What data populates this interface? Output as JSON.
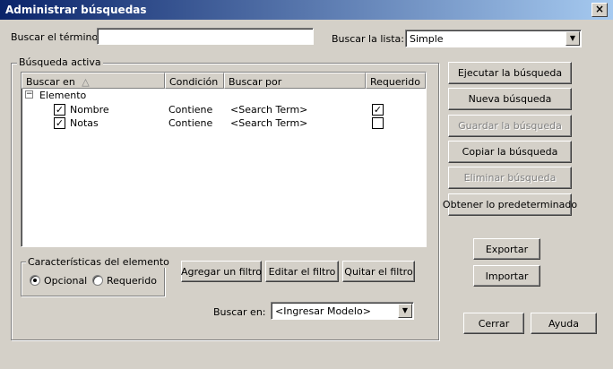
{
  "window": {
    "title": "Administrar búsquedas",
    "close_glyph": "×"
  },
  "top": {
    "term_label": "Buscar el término:",
    "term_value": "",
    "list_label": "Buscar la lista:",
    "list_value": "Simple"
  },
  "active_search": {
    "legend": "Búsqueda activa",
    "columns": [
      "Buscar en",
      "Condición",
      "Buscar por",
      "Requerido"
    ],
    "sort_glyph": "△",
    "group": {
      "expander": "−",
      "label": "Elemento"
    },
    "rows": [
      {
        "name": "Nombre",
        "condition": "Contiene",
        "search_by": "<Search Term>",
        "checked": true,
        "required": true
      },
      {
        "name": "Notas",
        "condition": "Contiene",
        "search_by": "<Search Term>",
        "checked": true,
        "required": false
      }
    ],
    "check_glyph": "✓"
  },
  "features": {
    "legend": "Características del elemento",
    "optional_label": "Opcional",
    "required_label": "Requerido",
    "selected": "Opcional"
  },
  "filter_buttons": {
    "add": "Agregar un filtro",
    "edit": "Editar el filtro",
    "remove": "Quitar el filtro"
  },
  "search_in": {
    "label": "Buscar en:",
    "value": "<Ingresar Modelo>"
  },
  "actions": {
    "run": "Ejecutar la búsqueda",
    "new": "Nueva búsqueda",
    "save": "Guardar la búsqueda",
    "copy": "Copiar la búsqueda",
    "delete": "Eliminar búsqueda",
    "defaults": "Obtener lo predeterminado",
    "export": "Exportar",
    "import": "Importar",
    "close": "Cerrar",
    "help": "Ayuda"
  },
  "icons": {
    "dropdown": "▼"
  }
}
